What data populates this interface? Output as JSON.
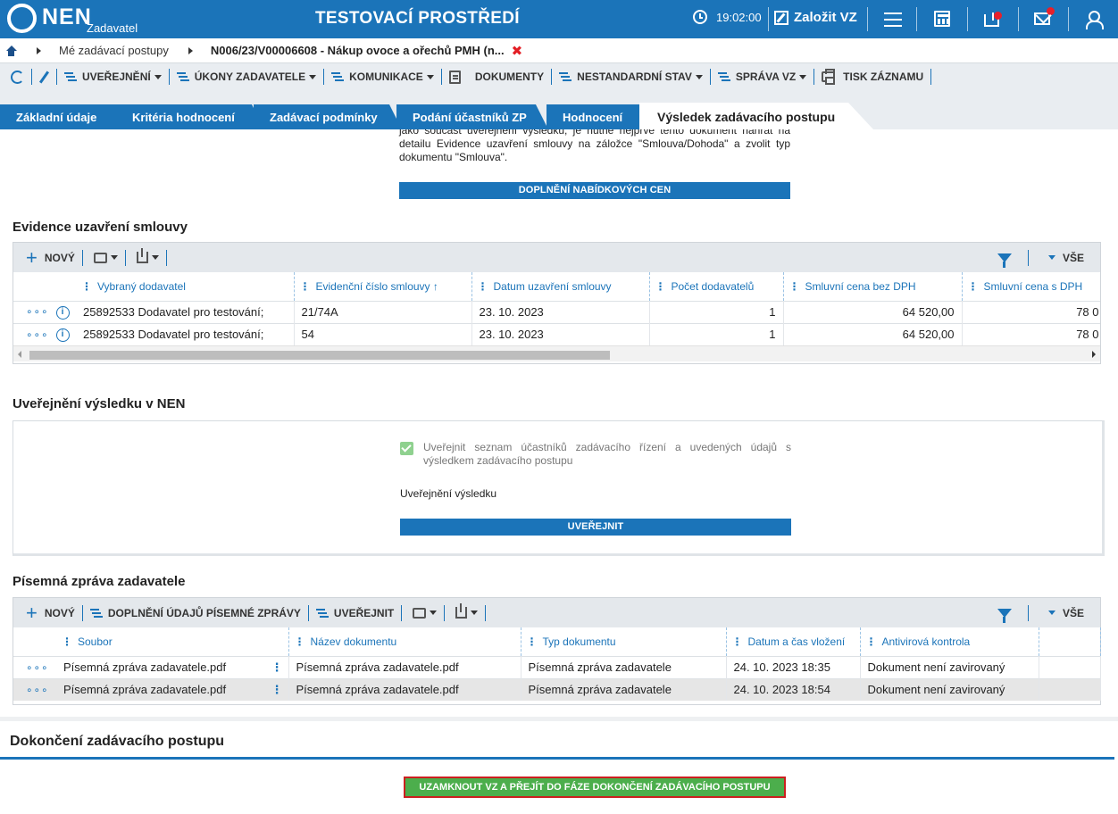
{
  "topbar": {
    "logo_text": "NEN",
    "logo_sub": "Zadavatel",
    "environment": "TESTOVACÍ PROSTŘEDÍ",
    "time": "19:02:00",
    "create_label": "Založit VZ",
    "colors": {
      "bar": "#1b74b9",
      "notification_dot": "#e8202a"
    }
  },
  "breadcrumb": {
    "items": [
      "Mé zadávací postupy",
      "N006/23/V00006608 - Nákup ovoce a ořechů PMH (n..."
    ],
    "close_glyph": "✖"
  },
  "actionbar": {
    "items": [
      "UVEŘEJNĚNÍ",
      "ÚKONY ZADAVATELE",
      "KOMUNIKACE",
      "DOKUMENTY",
      "NESTANDARDNÍ STAV",
      "SPRÁVA VZ",
      "TISK ZÁZNAMU"
    ]
  },
  "tabs": [
    {
      "label": "Základní údaje",
      "active": false
    },
    {
      "label": "Kritéria hodnocení",
      "active": false
    },
    {
      "label": "Zadávací podmínky",
      "active": false
    },
    {
      "label": "Podání účastníků ZP",
      "active": false
    },
    {
      "label": "Hodnocení",
      "active": false
    },
    {
      "label": "Výsledek zadávacího postupu",
      "active": true
    }
  ],
  "upper": {
    "text": "jako součást uveřejnění výsledku, je nutné nejprve tento dokument nahrát na detailu Evidence uzavření smlouvy na záložce \"Smlouva/Dohoda\" a zvolit typ dokumentu \"Smlouva\".",
    "button": "DOPLNĚNÍ NABÍDKOVÝCH CEN"
  },
  "contracts": {
    "title": "Evidence uzavření smlouvy",
    "new_label": "NOVÝ",
    "all_label": "VŠE",
    "columns": [
      "Vybraný dodavatel",
      "Evidenční číslo smlouvy",
      "Datum uzavření smlouvy",
      "Počet dodavatelů",
      "Smluvní cena bez DPH",
      "Smluvní cena s DPH"
    ],
    "sort_indicator": "↑",
    "rows": [
      {
        "supplier": "25892533 Dodavatel pro testování;",
        "number": "21/74A",
        "date": "23. 10. 2023",
        "count": "1",
        "price": "64 520,00",
        "price_vat": "78 0"
      },
      {
        "supplier": "25892533 Dodavatel pro testování;",
        "number": "54",
        "date": "23. 10. 2023",
        "count": "1",
        "price": "64 520,00",
        "price_vat": "78 0"
      }
    ]
  },
  "publication": {
    "title": "Uveřejnění výsledku v NEN",
    "checkbox_label": "Uveřejnit seznam účastníků zadávacího řízení a uvedených údajů s výsledkem zadávacího postupu",
    "checked": true,
    "result_label": "Uveřejnění výsledku",
    "button": "UVEŘEJNIT"
  },
  "report": {
    "title": "Písemná zpráva zadavatele",
    "new_label": "NOVÝ",
    "fill_label": "DOPLNĚNÍ ÚDAJŮ PÍSEMNÉ ZPRÁVY",
    "publish_label": "UVEŘEJNIT",
    "all_label": "VŠE",
    "columns": [
      "Soubor",
      "Název dokumentu",
      "Typ dokumentu",
      "Datum a čas vložení",
      "Antivirová kontrola"
    ],
    "rows": [
      {
        "file": "Písemná zpráva zadavatele.pdf",
        "name": "Písemná zpráva zadavatele.pdf",
        "type": "Písemná zpráva zadavatele",
        "datetime": "24. 10. 2023 18:35",
        "antivirus": "Dokument není zavirovaný"
      },
      {
        "file": "Písemná zpráva zadavatele.pdf",
        "name": "Písemná zpráva zadavatele.pdf",
        "type": "Písemná zpráva zadavatele",
        "datetime": "24. 10. 2023 18:54",
        "antivirus": "Dokument není zavirovaný"
      }
    ]
  },
  "finish": {
    "title": "Dokončení zadávacího postupu",
    "button": "UZAMKNOUT VZ A PŘEJÍT DO FÁZE DOKONČENÍ ZADÁVACÍHO POSTUPU",
    "button_color": "#4cae4c",
    "highlight_color": "#cc1f1f"
  }
}
